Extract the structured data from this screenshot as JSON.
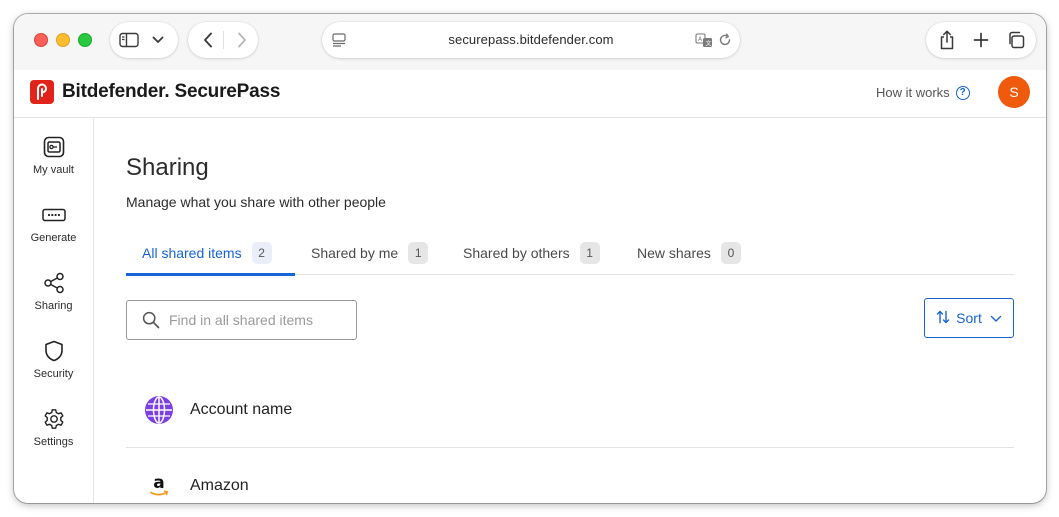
{
  "browser": {
    "url": "securepass.bitdefender.com"
  },
  "app": {
    "brand_name": "Bitdefender. SecurePass",
    "how_it_works": "How it works",
    "how_it_works_icon": "help-circle-icon",
    "avatar_initial": "S",
    "colors": {
      "brand_red": "#e2231a",
      "accent_blue": "#1664d6",
      "avatar_orange": "#f05a0c",
      "globe_purple": "#7b3fe4"
    }
  },
  "nav": {
    "items": [
      {
        "label": "My vault",
        "icon": "vault-icon"
      },
      {
        "label": "Generate",
        "icon": "password-generate-icon"
      },
      {
        "label": "Sharing",
        "icon": "share-icon"
      },
      {
        "label": "Security",
        "icon": "shield-icon"
      },
      {
        "label": "Settings",
        "icon": "gear-icon"
      }
    ]
  },
  "page": {
    "title": "Sharing",
    "subtitle": "Manage what you share with other people"
  },
  "tabs": [
    {
      "label": "All shared items",
      "count": "2",
      "active": true
    },
    {
      "label": "Shared by me",
      "count": "1",
      "active": false
    },
    {
      "label": "Shared by others",
      "count": "1",
      "active": false
    },
    {
      "label": "New shares",
      "count": "0",
      "active": false
    }
  ],
  "search": {
    "placeholder": "Find in all shared items",
    "value": ""
  },
  "sort": {
    "label": "Sort"
  },
  "items": [
    {
      "name": "Account name",
      "icon": "globe-icon"
    },
    {
      "name": "Amazon",
      "icon": "amazon-logo-icon"
    }
  ]
}
